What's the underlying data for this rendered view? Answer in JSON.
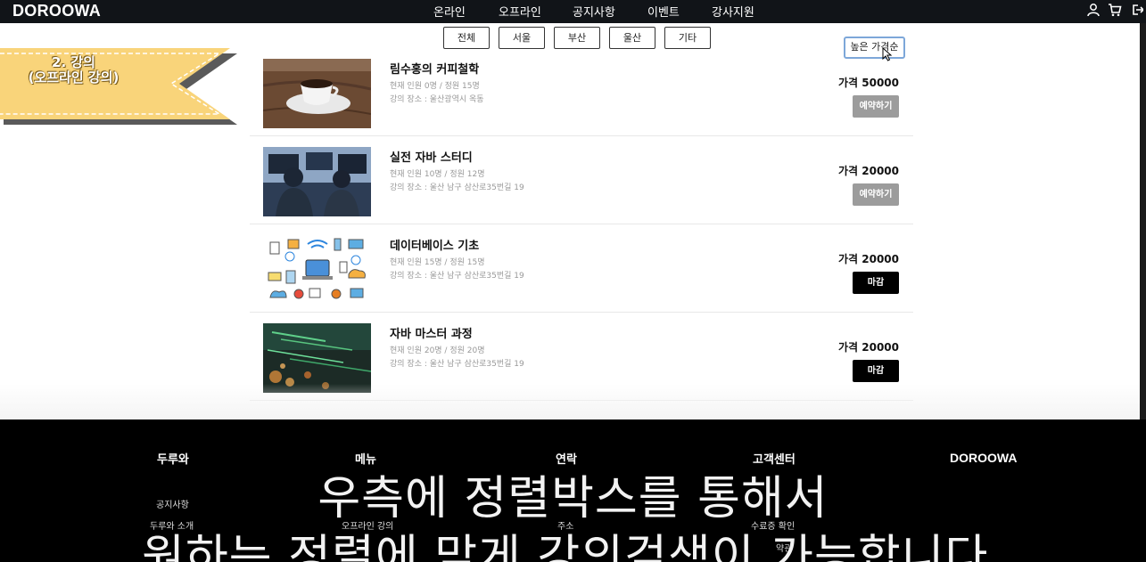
{
  "header": {
    "logo": "DOROOWA",
    "nav": [
      "온라인",
      "오프라인",
      "공지사항",
      "이벤트",
      "강사지원"
    ],
    "icons": [
      "user-icon",
      "cart-icon",
      "logout-icon"
    ]
  },
  "banner": {
    "line1": "2. 강의",
    "line2": "(오프라인 강의)",
    "color": "#f9d47a"
  },
  "filters": [
    "전체",
    "서울",
    "부산",
    "울산",
    "기타"
  ],
  "sort": {
    "selected": "높은 가격순"
  },
  "courses": [
    {
      "title": "림수홍의 커피철학",
      "enroll": "현재 인원 0명 / 정원 15명",
      "place": "강의 장소 : 울산광역시 옥동",
      "price": "가격 50000",
      "button": "예약하기",
      "status": "open",
      "thumb": "coffee-cup-image"
    },
    {
      "title": "실전 자바 스터디",
      "enroll": "현재 인원 10명 / 정원 12명",
      "place": "강의 장소 : 울산 남구 삼산로35번길 19",
      "price": "가격 20000",
      "button": "예약하기",
      "status": "open",
      "thumb": "programmers-image"
    },
    {
      "title": "데이터베이스 기초",
      "enroll": "현재 인원 15명 / 정원 15명",
      "place": "강의 장소 : 울산 남구 삼산로35번길 19",
      "price": "가격 20000",
      "button": "마감",
      "status": "closed",
      "thumb": "network-icons-image"
    },
    {
      "title": "자바 마스터 과정",
      "enroll": "현재 인원 20명 / 정원 20명",
      "place": "강의 장소 : 울산 남구 삼산로35번길 19",
      "price": "가격 20000",
      "button": "마감",
      "status": "closed",
      "thumb": "code-screen-image"
    }
  ],
  "footer": {
    "headings": [
      "두루와",
      "메뉴",
      "연락",
      "고객센터"
    ],
    "brand": "DOROOWA",
    "links": {
      "notice": "공지사항",
      "about": "두루와 소개",
      "offline": "오프라인 강의",
      "address": "주소",
      "receipt": "수료증 확인",
      "terms": "약관"
    }
  },
  "subtitles": {
    "line1": "우측에 정렬박스를 통해서",
    "line2": "원하는 정렬에 맞게 강의검색이 가능합니다."
  },
  "colors": {
    "header_bg": "#111418",
    "footer_bg": "#000000",
    "button_open": "#9c9c9c",
    "button_closed": "#000000",
    "sort_border": "#7da7d9"
  }
}
